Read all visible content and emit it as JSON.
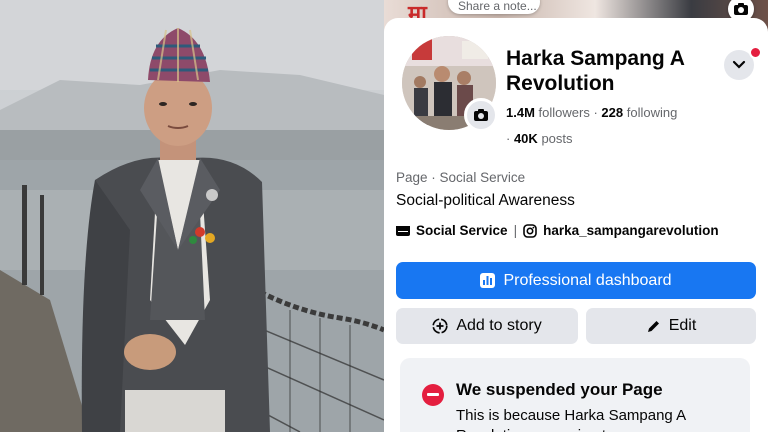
{
  "cover": {
    "overlay_text": "मा",
    "note_placeholder": "Share a note..."
  },
  "profile": {
    "name": "Harka Sampang A Revolution",
    "followers_count": "1.4M",
    "followers_label": "followers",
    "following_count": "228",
    "following_label": "following",
    "posts_count": "40K",
    "posts_label": "posts"
  },
  "about": {
    "page_type": "Page",
    "category": "Social Service",
    "bio": "Social-political Awareness",
    "link_1": "Social Service",
    "link_2": "harka_sampangarevolution"
  },
  "actions": {
    "dashboard_label": "Professional dashboard",
    "add_story_label": "Add to story",
    "edit_label": "Edit"
  },
  "notice": {
    "title": "We suspended your Page",
    "body": "This is because Harka Sampang A Revolution was using to..."
  },
  "colors": {
    "brand_blue": "#1877f2",
    "alert_red": "#e41e3f",
    "button_grey": "#e4e6eb"
  },
  "icons": [
    "camera-icon",
    "chevron-down-icon",
    "notification-dot",
    "video-category-icon",
    "instagram-icon",
    "dashboard-chart-icon",
    "add-story-icon",
    "pencil-icon",
    "suspended-icon"
  ]
}
